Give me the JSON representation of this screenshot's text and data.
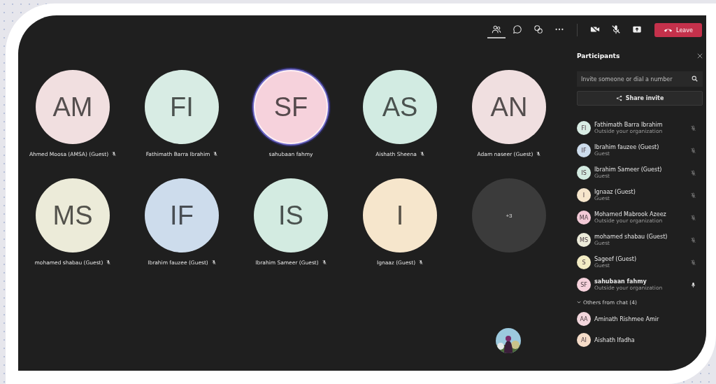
{
  "toolbar": {
    "buttons": [
      {
        "kind": "people",
        "selected": true
      },
      {
        "kind": "chat",
        "selected": false
      },
      {
        "kind": "reactions",
        "selected": false
      },
      {
        "kind": "more",
        "selected": false
      },
      {
        "kind": "camera",
        "selected": false
      },
      {
        "kind": "mic",
        "selected": false
      },
      {
        "kind": "share",
        "selected": false
      }
    ],
    "leave_label": "Leave"
  },
  "tiles": [
    {
      "kind": "avatar",
      "initials": "AM",
      "name": "Ahmed Moosa (AMSA) (Guest)",
      "muted": true,
      "speaking": false,
      "color": "#f1dfe0"
    },
    {
      "kind": "avatar",
      "initials": "FI",
      "name": "Fathimath Barra Ibrahim",
      "muted": true,
      "speaking": false,
      "color": "#d8ece4"
    },
    {
      "kind": "avatar",
      "initials": "SF",
      "name": "sahubaan fahmy",
      "muted": false,
      "speaking": true,
      "color": "#f6d2dc"
    },
    {
      "kind": "avatar",
      "initials": "AS",
      "name": "Aishath Sheena",
      "muted": true,
      "speaking": false,
      "color": "#d2ebe2"
    },
    {
      "kind": "avatar",
      "initials": "AN",
      "name": "Adam naseer (Guest)",
      "muted": true,
      "speaking": false,
      "color": "#f0dfe0"
    },
    {
      "kind": "avatar",
      "initials": "MS",
      "name": "mohamed shabau (Guest)",
      "muted": true,
      "speaking": false,
      "color": "#ecebd9"
    },
    {
      "kind": "avatar",
      "initials": "IF",
      "name": "Ibrahim fauzee (Guest)",
      "muted": true,
      "speaking": false,
      "color": "#cddcec"
    },
    {
      "kind": "avatar",
      "initials": "IS",
      "name": "Ibrahim Sameer (Guest)",
      "muted": true,
      "speaking": false,
      "color": "#d3ebe1"
    },
    {
      "kind": "avatar",
      "initials": "I",
      "name": "Ignaaz (Guest)",
      "muted": true,
      "speaking": false,
      "color": "#f6e6cc"
    },
    {
      "kind": "overflow",
      "initials": "+3"
    }
  ],
  "participants": {
    "title": "Participants",
    "invite_placeholder": "Invite someone or dial a number",
    "share_label": "Share invite",
    "people": [
      {
        "initials": "FI",
        "name": "Fathimath Barra Ibrahim",
        "subtitle": "Outside your organization",
        "muted": true,
        "bold": false,
        "color": "#d8ece4"
      },
      {
        "initials": "IF",
        "name": "Ibrahim fauzee (Guest)",
        "subtitle": "Guest",
        "muted": true,
        "bold": false,
        "color": "#cddcec"
      },
      {
        "initials": "IS",
        "name": "Ibrahim Sameer (Guest)",
        "subtitle": "Guest",
        "muted": true,
        "bold": false,
        "color": "#d3ebe1"
      },
      {
        "initials": "I",
        "name": "Ignaaz (Guest)",
        "subtitle": "Guest",
        "muted": true,
        "bold": false,
        "color": "#f6e6cc"
      },
      {
        "initials": "MA",
        "name": "Mohamed Mabrook Azeez",
        "subtitle": "Outside your organization",
        "muted": true,
        "bold": false,
        "color": "#f2c9d6"
      },
      {
        "initials": "MS",
        "name": "mohamed shabau (Guest)",
        "subtitle": "Guest",
        "muted": true,
        "bold": false,
        "color": "#ecebd9"
      },
      {
        "initials": "S",
        "name": "Sageef (Guest)",
        "subtitle": "Guest",
        "muted": true,
        "bold": false,
        "color": "#f3ecc4"
      },
      {
        "initials": "SF",
        "name": "sahubaan fahmy",
        "subtitle": "Outside your organization",
        "muted": false,
        "bold": true,
        "color": "#f6d2dc"
      }
    ],
    "others_label": "Others from chat (4)",
    "others_expanded": true,
    "others": [
      {
        "initials": "AA",
        "name": "Aminath Rishmee Amir",
        "color": "#f2d6dc"
      },
      {
        "initials": "AI",
        "name": "Aishath Ifadha",
        "color": "#f5dcc8"
      }
    ]
  }
}
